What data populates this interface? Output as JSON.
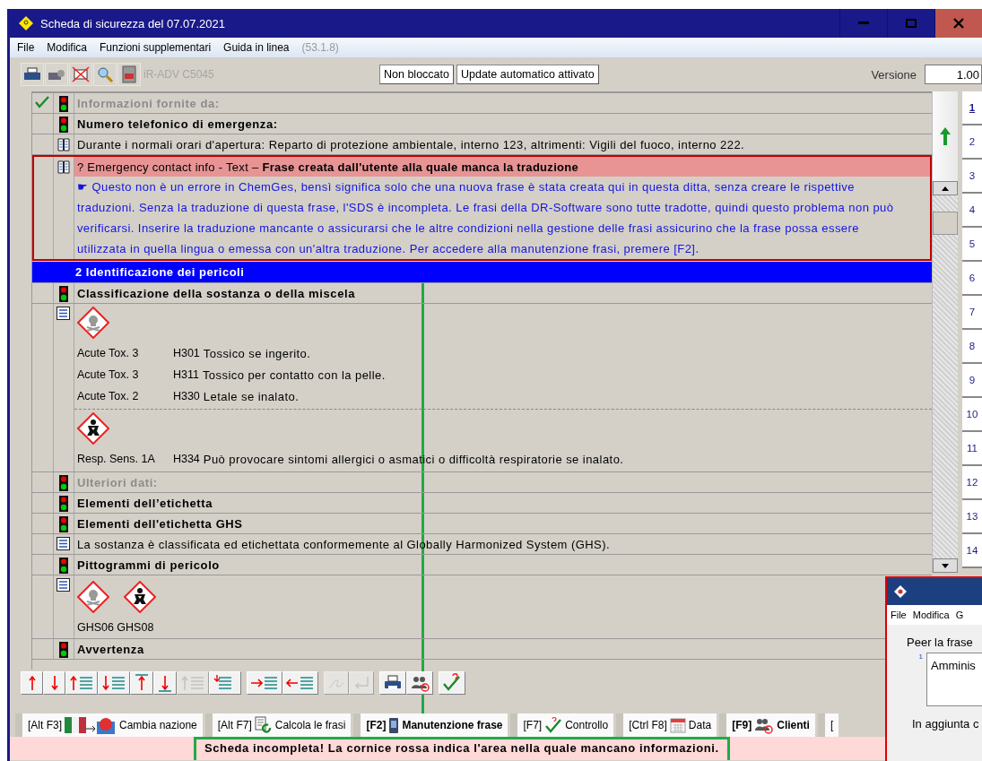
{
  "window": {
    "title": "Scheda di sicurezza del 07.07.2021"
  },
  "menu": [
    "File",
    "Modifica",
    "Funzioni supplementari",
    "Guida in linea"
  ],
  "version_tag": "(53.1.8)",
  "toolbar": {
    "printer": "iR-ADV C5045",
    "buttons": [
      "Non bloccato",
      "Update automatico attivato"
    ],
    "version_label": "Versione",
    "version_value": "1.00"
  },
  "rows": [
    {
      "kind": "heading",
      "text": "Informazioni fornite da:",
      "checked": true,
      "disabled": true
    },
    {
      "kind": "heading",
      "text": "Numero telefonico di emergenza:",
      "checked": false,
      "disabled": false
    },
    {
      "kind": "phrase",
      "text": "Durante i normali orari d'apertura: Reparto di protezione ambientale, interno 123, altrimenti: Vigili del fuoco, interno 222."
    },
    {
      "kind": "missing",
      "title": "? Emergency contact info - Text – **Frase creata dall'utente alla quale manca la traduzione**",
      "text": "☛ Questo non è un errore in ChemGes, bensì significa solo che una nuova frase è stata creata qui in questa ditta, senza creare le rispettive traduzioni. Senza la traduzione di questa frase, l'SDS è incompleta. Le frasi della DR-Software sono tutte tradotte, quindi questo problema non può verificarsi. Inserire la traduzione mancante o assicurarsi che le altre condizioni nella gestione delle frasi assicurino che la frase possa essere utilizzata in quella lingua o emessa con un'altra traduzione. Per accedere alla manutenzione frasi, premere [F2]."
    },
    {
      "kind": "section",
      "number": "2",
      "text": "Identificazione dei pericoli",
      "selected": true
    },
    {
      "kind": "heading",
      "text": "Classificazione della sostanza o della miscela",
      "checked": false,
      "disabled": false
    },
    {
      "kind": "hazards",
      "groups": [
        {
          "kind": "skull",
          "lines": [
            {
              "class": "Acute Tox. 3",
              "code": "H301",
              "text": "Tossico se ingerito."
            },
            {
              "class": "Acute Tox. 3",
              "code": "H311",
              "text": "Tossico per contatto con la pelle."
            },
            {
              "class": "Acute Tox. 2",
              "code": "H330",
              "text": "Letale se inalato."
            }
          ]
        },
        {
          "kind": "health",
          "lines": [
            {
              "class": "Resp. Sens. 1A",
              "code": "H334",
              "text": "Può provocare sintomi allergici o asmatici o difficoltà respiratorie se inalato."
            }
          ]
        }
      ]
    },
    {
      "kind": "heading",
      "text": "Ulteriori dati:",
      "checked": false,
      "disabled": true
    },
    {
      "kind": "heading",
      "text": "Elementi dell’etichetta",
      "checked": false,
      "disabled": false
    },
    {
      "kind": "heading",
      "text": "Elementi dell'etichetta GHS",
      "checked": false,
      "disabled": false
    },
    {
      "kind": "statement",
      "text": "La sostanza è classificata ed etichettata conformemente al Globally Harmonized System (GHS)."
    },
    {
      "kind": "heading",
      "text": "Pittogrammi di pericolo",
      "checked": false,
      "disabled": false
    },
    {
      "kind": "pictograms",
      "pictograms": [
        {
          "kind": "skull"
        },
        {
          "kind": "health"
        }
      ],
      "text": "GHS06 GHS08"
    },
    {
      "kind": "heading",
      "text": "Avvertenza",
      "checked": false,
      "disabled": false
    }
  ],
  "page_tabs": [
    {
      "label": "1",
      "selected": true
    },
    {
      "label": "2",
      "selected": false
    },
    {
      "label": "3",
      "selected": false
    },
    {
      "label": "4",
      "selected": false
    },
    {
      "label": "5",
      "selected": false
    },
    {
      "label": "6",
      "selected": false
    },
    {
      "label": "7",
      "selected": false
    },
    {
      "label": "8",
      "selected": false
    },
    {
      "label": "9",
      "selected": false
    },
    {
      "label": "10",
      "selected": false
    },
    {
      "label": "11",
      "selected": false
    },
    {
      "label": "12",
      "selected": false
    },
    {
      "label": "13",
      "selected": false
    },
    {
      "label": "14",
      "selected": false
    }
  ],
  "edit_tools": [
    {
      "kind": "up",
      "disabled": false
    },
    {
      "kind": "down",
      "disabled": false
    },
    {
      "kind": "up-lines",
      "disabled": false
    },
    {
      "kind": "down-lines",
      "disabled": false
    },
    {
      "kind": "top",
      "disabled": false
    },
    {
      "kind": "bottom",
      "disabled": false
    },
    {
      "kind": "up-lines",
      "disabled": true
    },
    {
      "kind": "insert-lines",
      "disabled": false
    },
    {
      "kind": "indent",
      "disabled": false
    },
    {
      "kind": "outdent",
      "disabled": false
    },
    {
      "kind": "sign",
      "disabled": true
    },
    {
      "kind": "enter",
      "disabled": true
    },
    {
      "kind": "print",
      "disabled": false
    },
    {
      "kind": "clients",
      "disabled": false
    },
    {
      "kind": "check",
      "disabled": false
    }
  ],
  "function_tabs": [
    {
      "kind": "country",
      "key": "[Alt F3]",
      "label": "Cambia nazione",
      "bold": false
    },
    {
      "kind": "calculate",
      "key": "[Alt F7]",
      "label": "Calcola le frasi",
      "bold": false
    },
    {
      "kind": "maintenance",
      "key": "[F2]",
      "label": "Manutenzione frase",
      "bold": true
    },
    {
      "kind": "check",
      "key": "[F7]",
      "label": "Controllo",
      "bold": false
    },
    {
      "kind": "date",
      "key": "[Ctrl F8]",
      "label": "Data",
      "bold": false
    },
    {
      "kind": "clients",
      "key": "[F9]",
      "label": "Clienti",
      "bold": true
    },
    {
      "kind": "none",
      "key": "[",
      "bold": false
    }
  ],
  "status": "Scheda incompleta! La cornice rossa indica l'area nella quale mancano informazioni.",
  "popup": {
    "menu": [
      "File",
      "Modifica",
      "G"
    ],
    "prompt": "Peer la frase",
    "line_number": "1",
    "value": "Amminis",
    "note": "In aggiunta c"
  }
}
